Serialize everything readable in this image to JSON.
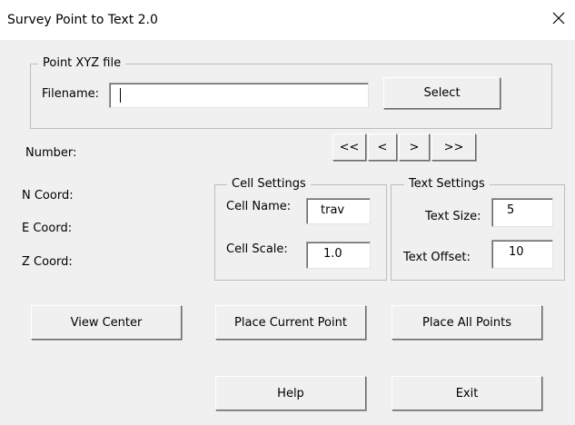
{
  "window": {
    "title": "Survey Point to Text 2.0",
    "close_icon": "close-icon"
  },
  "file_group": {
    "legend": "Point XYZ file",
    "filename_label": "Filename:",
    "filename_value": "",
    "select_button": "Select"
  },
  "navigation": {
    "number_label": "Number:",
    "first_button": "<<",
    "prev_button": "<",
    "next_button": ">",
    "last_button": ">>"
  },
  "coords": {
    "n_label": "N Coord:",
    "e_label": "E Coord:",
    "z_label": "Z Coord:"
  },
  "cell_settings": {
    "legend": "Cell Settings",
    "name_label": "Cell Name:",
    "name_value": "trav",
    "scale_label": "Cell Scale:",
    "scale_value": "1.0"
  },
  "text_settings": {
    "legend": "Text Settings",
    "size_label": "Text Size:",
    "size_value": "5",
    "offset_label": "Text Offset:",
    "offset_value": "10"
  },
  "actions": {
    "view_center": "View Center",
    "place_current": "Place Current Point",
    "place_all": "Place All Points",
    "help": "Help",
    "exit": "Exit"
  }
}
